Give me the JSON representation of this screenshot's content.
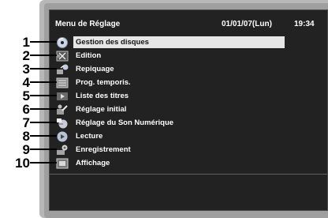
{
  "header": {
    "title": "Menu de Réglage",
    "date": "01/01/07(Lun)",
    "time": "19:34"
  },
  "menu": {
    "items": [
      {
        "label": "Gestion des disques",
        "icon": "disc-management-icon",
        "selected": true
      },
      {
        "label": "Edition",
        "icon": "edit-icon",
        "selected": false
      },
      {
        "label": "Repiquage",
        "icon": "dubbing-icon",
        "selected": false
      },
      {
        "label": "Prog. temporis.",
        "icon": "timer-program-icon",
        "selected": false
      },
      {
        "label": "Liste des titres",
        "icon": "title-list-icon",
        "selected": false
      },
      {
        "label": "Réglage initial",
        "icon": "initial-setting-icon",
        "selected": false
      },
      {
        "label": "Réglage du Son Numérique",
        "icon": "digital-audio-icon",
        "selected": false
      },
      {
        "label": "Lecture",
        "icon": "playback-icon",
        "selected": false
      },
      {
        "label": "Enregistrement",
        "icon": "recording-icon",
        "selected": false
      },
      {
        "label": "Affichage",
        "icon": "display-icon",
        "selected": false
      }
    ]
  },
  "callouts": [
    "1",
    "2",
    "3",
    "4",
    "5",
    "6",
    "7",
    "8",
    "9",
    "10"
  ],
  "colors": {
    "screen_bg": "#222222",
    "selection": "#e6e6e6",
    "bezel": "#b7b7b7",
    "text": "#ffffff"
  }
}
